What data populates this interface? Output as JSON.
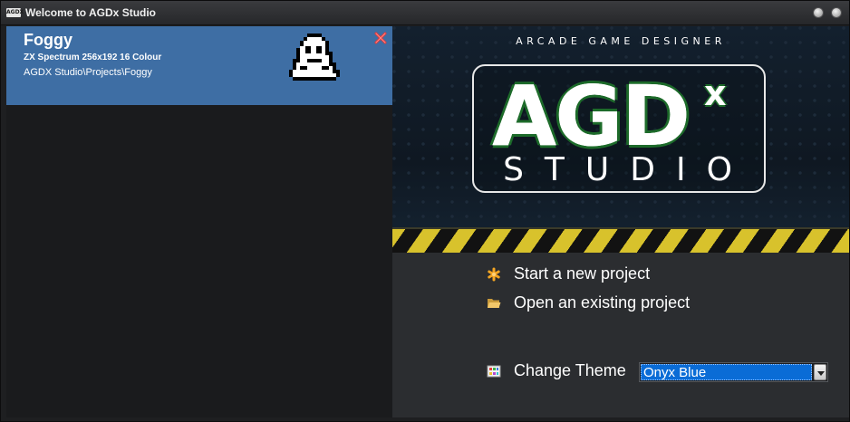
{
  "window": {
    "title": "Welcome to AGDx Studio",
    "app_icon_text": "AGDX"
  },
  "projects": [
    {
      "name": "Foggy",
      "platform": "ZX Spectrum 256x192 16 Colour",
      "path": "AGDX Studio\\Projects\\Foggy",
      "sprite_icon": "foggy-sprite-icon",
      "remove_icon": "close-icon"
    }
  ],
  "banner": {
    "tagline": "ARCADE GAME DESIGNER",
    "logo_main": "AGD",
    "logo_superscript": "x",
    "logo_sub": "STUDIO"
  },
  "actions": {
    "new_project": {
      "label": "Start a new project",
      "icon": "asterisk-icon"
    },
    "open_project": {
      "label": "Open an existing project",
      "icon": "folder-open-icon"
    }
  },
  "theme": {
    "label": "Change Theme",
    "icon": "palette-icon",
    "selected": "Onyx Blue"
  },
  "colors": {
    "selection_blue": "#3e6ea4",
    "dropdown_highlight": "#0a6cd6",
    "remove_red": "#e03a3a",
    "asterisk_orange": "#f5a623",
    "hazard_yellow": "#d8c22c",
    "logo_green": "#1d6b2a"
  }
}
